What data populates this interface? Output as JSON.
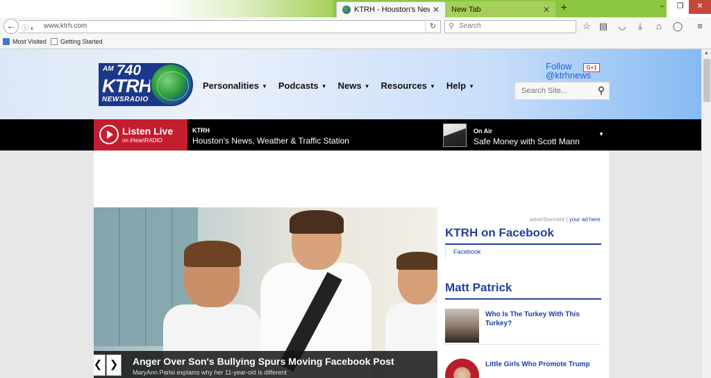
{
  "browser": {
    "tabs": [
      {
        "title": "KTRH - Houston's News, ...",
        "active": true
      },
      {
        "title": "New Tab",
        "active": false
      }
    ],
    "url": "www.ktrh.com",
    "search_placeholder": "Search",
    "bookmarks": [
      "Most Visited",
      "Getting Started"
    ],
    "window_controls": {
      "min": "–",
      "max": "❐",
      "close": "✕"
    }
  },
  "site": {
    "logo": {
      "am": "AM",
      "freq": "740",
      "call": "KTRH",
      "tag": "NEWSRADIO"
    },
    "nav": [
      {
        "label": "Personalities"
      },
      {
        "label": "Podcasts"
      },
      {
        "label": "News"
      },
      {
        "label": "Resources"
      },
      {
        "label": "Help"
      }
    ],
    "follow": {
      "line1": "Follow",
      "handle": "@ktrhnews",
      "gplus": "G+1"
    },
    "search_placeholder": "Search Site..."
  },
  "player": {
    "listen_label": "Listen Live",
    "on_label": "on iHeartRADIO",
    "station_call": "KTRH",
    "station_desc": "Houston's News, Weather & Traffic Station",
    "on_air_label": "On Air",
    "show": "Safe Money with Scott Mann"
  },
  "hero": {
    "headline": "Anger Over Son's Bullying Spurs Moving Facebook Post",
    "subline": "MaryAnn Parisi explains why her 11-year-old is different",
    "prev": "❮",
    "next": "❯"
  },
  "sidebar": {
    "ad_note": "advertisement",
    "ad_sep": " | ",
    "ad_link": "your ad here",
    "facebook_title": "KTRH on Facebook",
    "facebook_link": "Facebook",
    "section_title": "Matt Patrick",
    "stories": [
      {
        "title": "Who Is The Turkey With This Turkey?"
      },
      {
        "title": "Little Girls Who Promote Trump"
      }
    ]
  },
  "colors": {
    "brand_blue": "#233f9c",
    "listen_red": "#c41d2f",
    "tab_green": "#8dc63f"
  }
}
